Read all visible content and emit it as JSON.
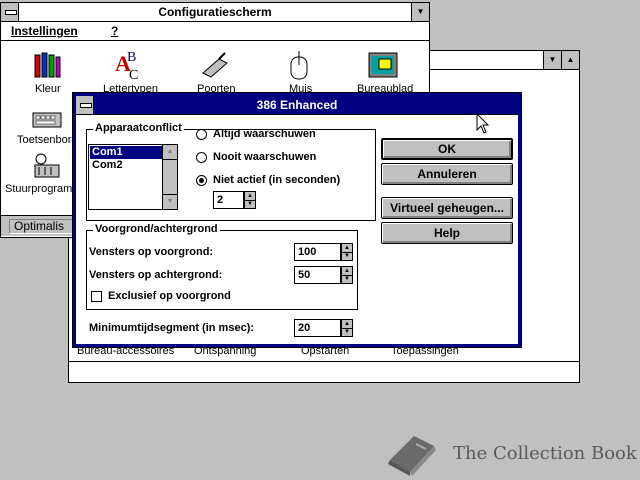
{
  "control_panel": {
    "title": "Configuratiescherm",
    "menu": [
      "Instellingen",
      "?"
    ],
    "icons": [
      {
        "name": "kleur-icon",
        "label": "Kleur"
      },
      {
        "name": "lettertypen-icon",
        "label": "Lettertypen"
      },
      {
        "name": "poorten-icon",
        "label": "Poorten"
      },
      {
        "name": "muis-icon",
        "label": "Muis"
      },
      {
        "name": "bureaublad-icon",
        "label": "Bureaublad"
      },
      {
        "name": "toetsenbord-icon",
        "label": "Toetsenbord"
      },
      {
        "name": "stuurprogramma-icon",
        "label": "Stuurprogramm"
      }
    ],
    "status": "Optimalis"
  },
  "program_manager": {
    "groups": [
      "Bureau-accessoires",
      "Ontspanning",
      "Opstarten",
      "Toepassingen"
    ]
  },
  "dialog": {
    "title": "386 Enhanced",
    "device_conflict": {
      "label": "Apparaatconflict",
      "ports": [
        "Com1",
        "Com2"
      ],
      "selected_port": "Com1",
      "options": [
        "Altijd waarschuwen",
        "Nooit waarschuwen",
        "Niet actief (in seconden)"
      ],
      "selected_option": "Niet actief (in seconden)",
      "idle_seconds": "2"
    },
    "buttons": {
      "ok": "OK",
      "cancel": "Annuleren",
      "virtual_memory": "Virtueel geheugen...",
      "help": "Help"
    },
    "scheduling": {
      "label": "Voorgrond/achtergrond",
      "foreground_label": "Vensters op voorgrond:",
      "foreground_value": "100",
      "background_label": "Vensters op achtergrond:",
      "background_value": "50",
      "exclusive_label": "Exclusief op voorgrond",
      "exclusive_checked": false
    },
    "min_timeslice_label": "Minimumtijdsegment (in msec):",
    "min_timeslice_value": "20"
  },
  "watermark": "The Collection Book"
}
